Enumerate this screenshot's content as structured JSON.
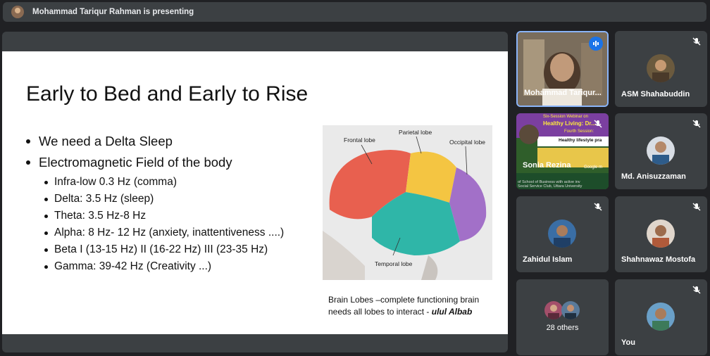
{
  "top_bar": {
    "presenter_text": "Mohammad Tariqur Rahman is presenting"
  },
  "slide": {
    "title": "Early to Bed and Early to Rise",
    "bullets": [
      {
        "text": "We need a Delta Sleep",
        "level": 1
      },
      {
        "text": "Electromagnetic Field of the body",
        "level": 1
      },
      {
        "text": "Infra-low 0.3 Hz (comma)",
        "level": 2
      },
      {
        "text": "Delta: 3.5 Hz (sleep)",
        "level": 2
      },
      {
        "text": "Theta: 3.5 Hz-8 Hz",
        "level": 2
      },
      {
        "text": "Alpha: 8 Hz- 12 Hz (anxiety, inattentiveness ....)",
        "level": 2
      },
      {
        "text": "Beta I (13-15 Hz) II (16-22 Hz) III (23-35 Hz)",
        "level": 2
      },
      {
        "text": "Gamma: 39-42 Hz (Creativity ...)",
        "level": 2
      }
    ],
    "brain_labels": {
      "frontal": "Frontal lobe",
      "parietal": "Parietal lobe",
      "occipital": "Occipital lobe",
      "temporal": "Temporal lobe"
    },
    "caption_line1": "Brain Lobes –complete functioning brain",
    "caption_line2": "needs all lobes to interact   - ",
    "caption_author": "ulul Albab"
  },
  "participants": [
    {
      "name": "Mohammad Tariqur...",
      "type": "video"
    },
    {
      "name": "ASM Shahabuddin",
      "type": "avatar",
      "muted": true,
      "color": "#6b5a3e"
    },
    {
      "name": "Sonia Rezina",
      "type": "presentation",
      "muted": true
    },
    {
      "name": "Md. Anisuzzaman",
      "type": "avatar",
      "muted": true,
      "color": "#2e5c8a"
    },
    {
      "name": "Zahidul Islam",
      "type": "avatar",
      "muted": true,
      "color": "#3a6ea5"
    },
    {
      "name": "Shahnawaz Mostofa",
      "type": "avatar",
      "muted": true,
      "color": "#b05a3a"
    },
    {
      "name": "28 others",
      "type": "group"
    },
    {
      "name": "You",
      "type": "avatar",
      "muted": true,
      "color": "#3d7a5a"
    }
  ],
  "sonia_tile": {
    "line1": "Six-Session Webinar on",
    "line2": "Healthy Living: Dr...",
    "line3": "Fourth Session:",
    "line4": "Healthy lifestyle pra",
    "line5": "Google m",
    "line6": "of School of Business with active inv",
    "line7": "Social Service Club, Uttara University"
  }
}
